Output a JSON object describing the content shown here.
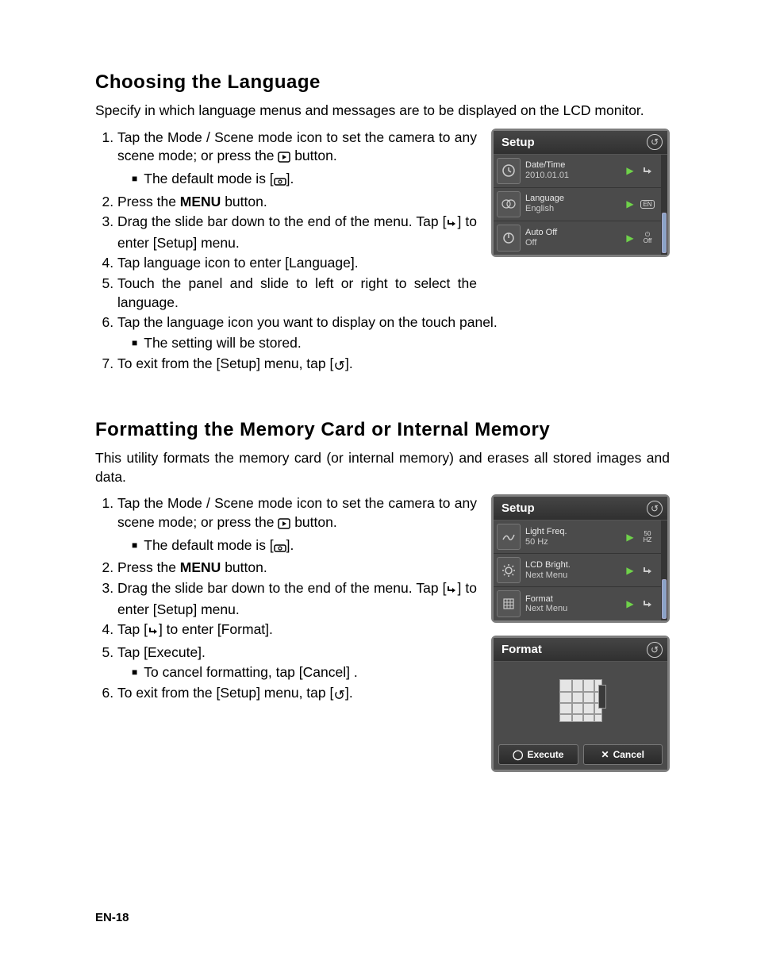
{
  "section1": {
    "heading": "Choosing the Language",
    "intro": "Specify in which language menus and messages are to be displayed on the LCD monitor.",
    "steps_upper": [
      {
        "text": "Tap the Mode / Scene  mode icon to set the camera to any scene mode; or press the ",
        "after_icon": " button.",
        "sub": "The default mode is [",
        "sub_after": "]."
      },
      {
        "text": "Press the ",
        "bold": "MENU",
        "after": " button."
      },
      {
        "text": "Drag the slide bar down to the end of the menu. Tap [",
        "after_icon": "] to enter [Setup] menu."
      },
      {
        "text": "Tap language icon to enter  [Language]."
      },
      {
        "text": "Touch the panel and slide to left or right to select the language."
      }
    ],
    "steps_lower": [
      {
        "text": "Tap  the language  icon you want to display on the touch panel.",
        "sub": "The setting will be stored."
      },
      {
        "text": "To exit from the [Setup] menu, tap [",
        "after_icon": "]."
      }
    ]
  },
  "section2": {
    "heading": "Formatting the Memory Card or Internal Memory",
    "intro": "This utility formats the memory card (or internal memory) and erases all stored images and data.",
    "steps": [
      {
        "text": "Tap the Mode / Scene  mode icon to set the camera to any scene mode; or press the ",
        "after_icon": " button.",
        "sub": "The default mode is [",
        "sub_after": "]."
      },
      {
        "text": "Press the ",
        "bold": "MENU",
        "after": " button."
      },
      {
        "text": "Drag the slide bar down to the end of the menu. Tap [",
        "after_icon": "] to enter [Setup] menu."
      },
      {
        "text": "Tap [",
        "after_icon": "] to enter  [Format]."
      },
      {
        "text": "Tap [Execute].",
        "sub": "To cancel formatting, tap [Cancel] ."
      },
      {
        "text": "To exit from the [Setup] menu, tap [",
        "after_icon": "]."
      }
    ]
  },
  "panel1": {
    "title": "Setup",
    "rows": [
      {
        "label": "Date/Time",
        "value": "2010.01.01",
        "action": "enter-icon",
        "icon": "clock-icon"
      },
      {
        "label": "Language",
        "value": "English",
        "action": "en-badge",
        "action_text": "EN",
        "icon": "globe-icon"
      },
      {
        "label": "Auto Off",
        "value": "Off",
        "action": "power-off",
        "action_text": "Off",
        "icon": "power-icon"
      }
    ]
  },
  "panel2": {
    "title": "Setup",
    "rows": [
      {
        "label": "Light Freq.",
        "value": "50 Hz",
        "action": "hz-badge",
        "action_text_top": "50",
        "action_text_bot": "HZ",
        "icon": "wave-icon"
      },
      {
        "label": "LCD Bright.",
        "value": "Next Menu",
        "action": "enter-icon",
        "icon": "brightness-icon"
      },
      {
        "label": "Format",
        "value": "Next Menu",
        "action": "enter-icon",
        "icon": "card-icon"
      }
    ]
  },
  "panel3": {
    "title": "Format",
    "execute": "Execute",
    "cancel": "Cancel"
  },
  "page_number": "EN-18"
}
